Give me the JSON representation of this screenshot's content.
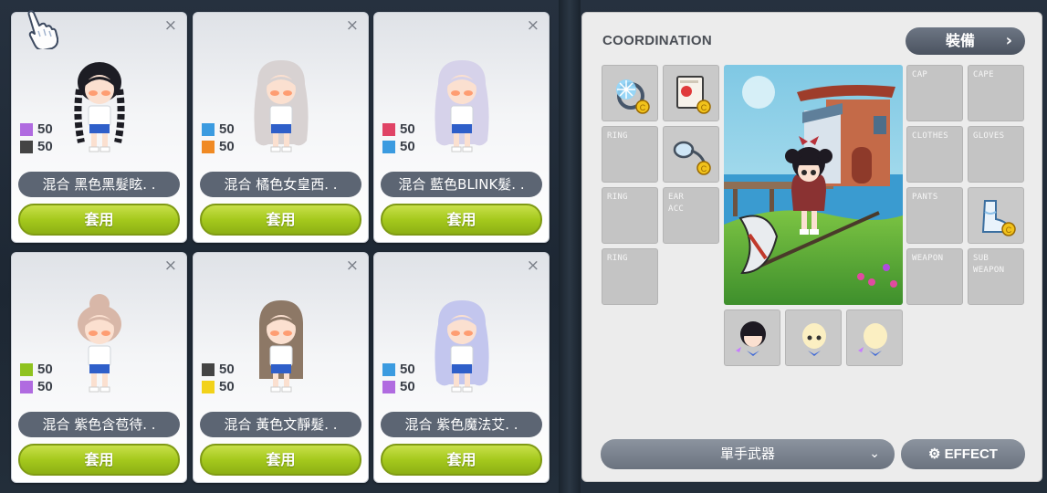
{
  "hair_cards": [
    {
      "stats": [
        {
          "value": "50",
          "color": "#b06be0"
        },
        {
          "value": "50",
          "color": "#444444"
        }
      ],
      "name": "混合 黑色黑髮眩. .",
      "apply_label": "套用",
      "hair_color": "#1d1d24",
      "style": "braids"
    },
    {
      "stats": [
        {
          "value": "50",
          "color": "#3b9be0"
        },
        {
          "value": "50",
          "color": "#f08a24"
        }
      ],
      "name": "混合 橘色女皇西. .",
      "apply_label": "套用",
      "hair_color": "#d8d2d2",
      "style": "long-wavy"
    },
    {
      "stats": [
        {
          "value": "50",
          "color": "#e04466"
        },
        {
          "value": "50",
          "color": "#3b9be0"
        }
      ],
      "name": "混合 藍色BLINK髮. .",
      "apply_label": "套用",
      "hair_color": "#d6d2ea",
      "style": "long-wavy"
    },
    {
      "stats": [
        {
          "value": "50",
          "color": "#8fc31f"
        },
        {
          "value": "50",
          "color": "#b06be0"
        }
      ],
      "name": "混合 紫色含苞待. .",
      "apply_label": "套用",
      "hair_color": "#d8b7a8",
      "style": "bun"
    },
    {
      "stats": [
        {
          "value": "50",
          "color": "#444444"
        },
        {
          "value": "50",
          "color": "#f2d21a"
        }
      ],
      "name": "混合 黃色文靜髮. .",
      "apply_label": "套用",
      "hair_color": "#8d7866",
      "style": "long-straight"
    },
    {
      "stats": [
        {
          "value": "50",
          "color": "#3b9be0"
        },
        {
          "value": "50",
          "color": "#b06be0"
        }
      ],
      "name": "混合 紫色魔法艾. .",
      "apply_label": "套用",
      "hair_color": "#c3c6ee",
      "style": "long-wavy"
    }
  ],
  "coordination": {
    "title": "COORDINATION",
    "equip_button": "裝備",
    "slot_labels": {
      "ring1": "RING",
      "ring2": "RING",
      "ring3": "RING",
      "ear_acc": "EAR\nACC",
      "cap": "CAP",
      "cape": "CAPE",
      "clothes": "CLOTHES",
      "gloves": "GLOVES",
      "pants": "PANTS",
      "weapon": "WEAPON",
      "sub_weapon": "SUB\nWEAPON"
    },
    "weapon_select": "單手武器",
    "effect_button": "EFFECT"
  },
  "colors": {
    "apply_green": "#a5c91d",
    "name_pill": "#5c6573",
    "panel_bg": "#ececec",
    "slot_bg": "#c4c4c4"
  }
}
